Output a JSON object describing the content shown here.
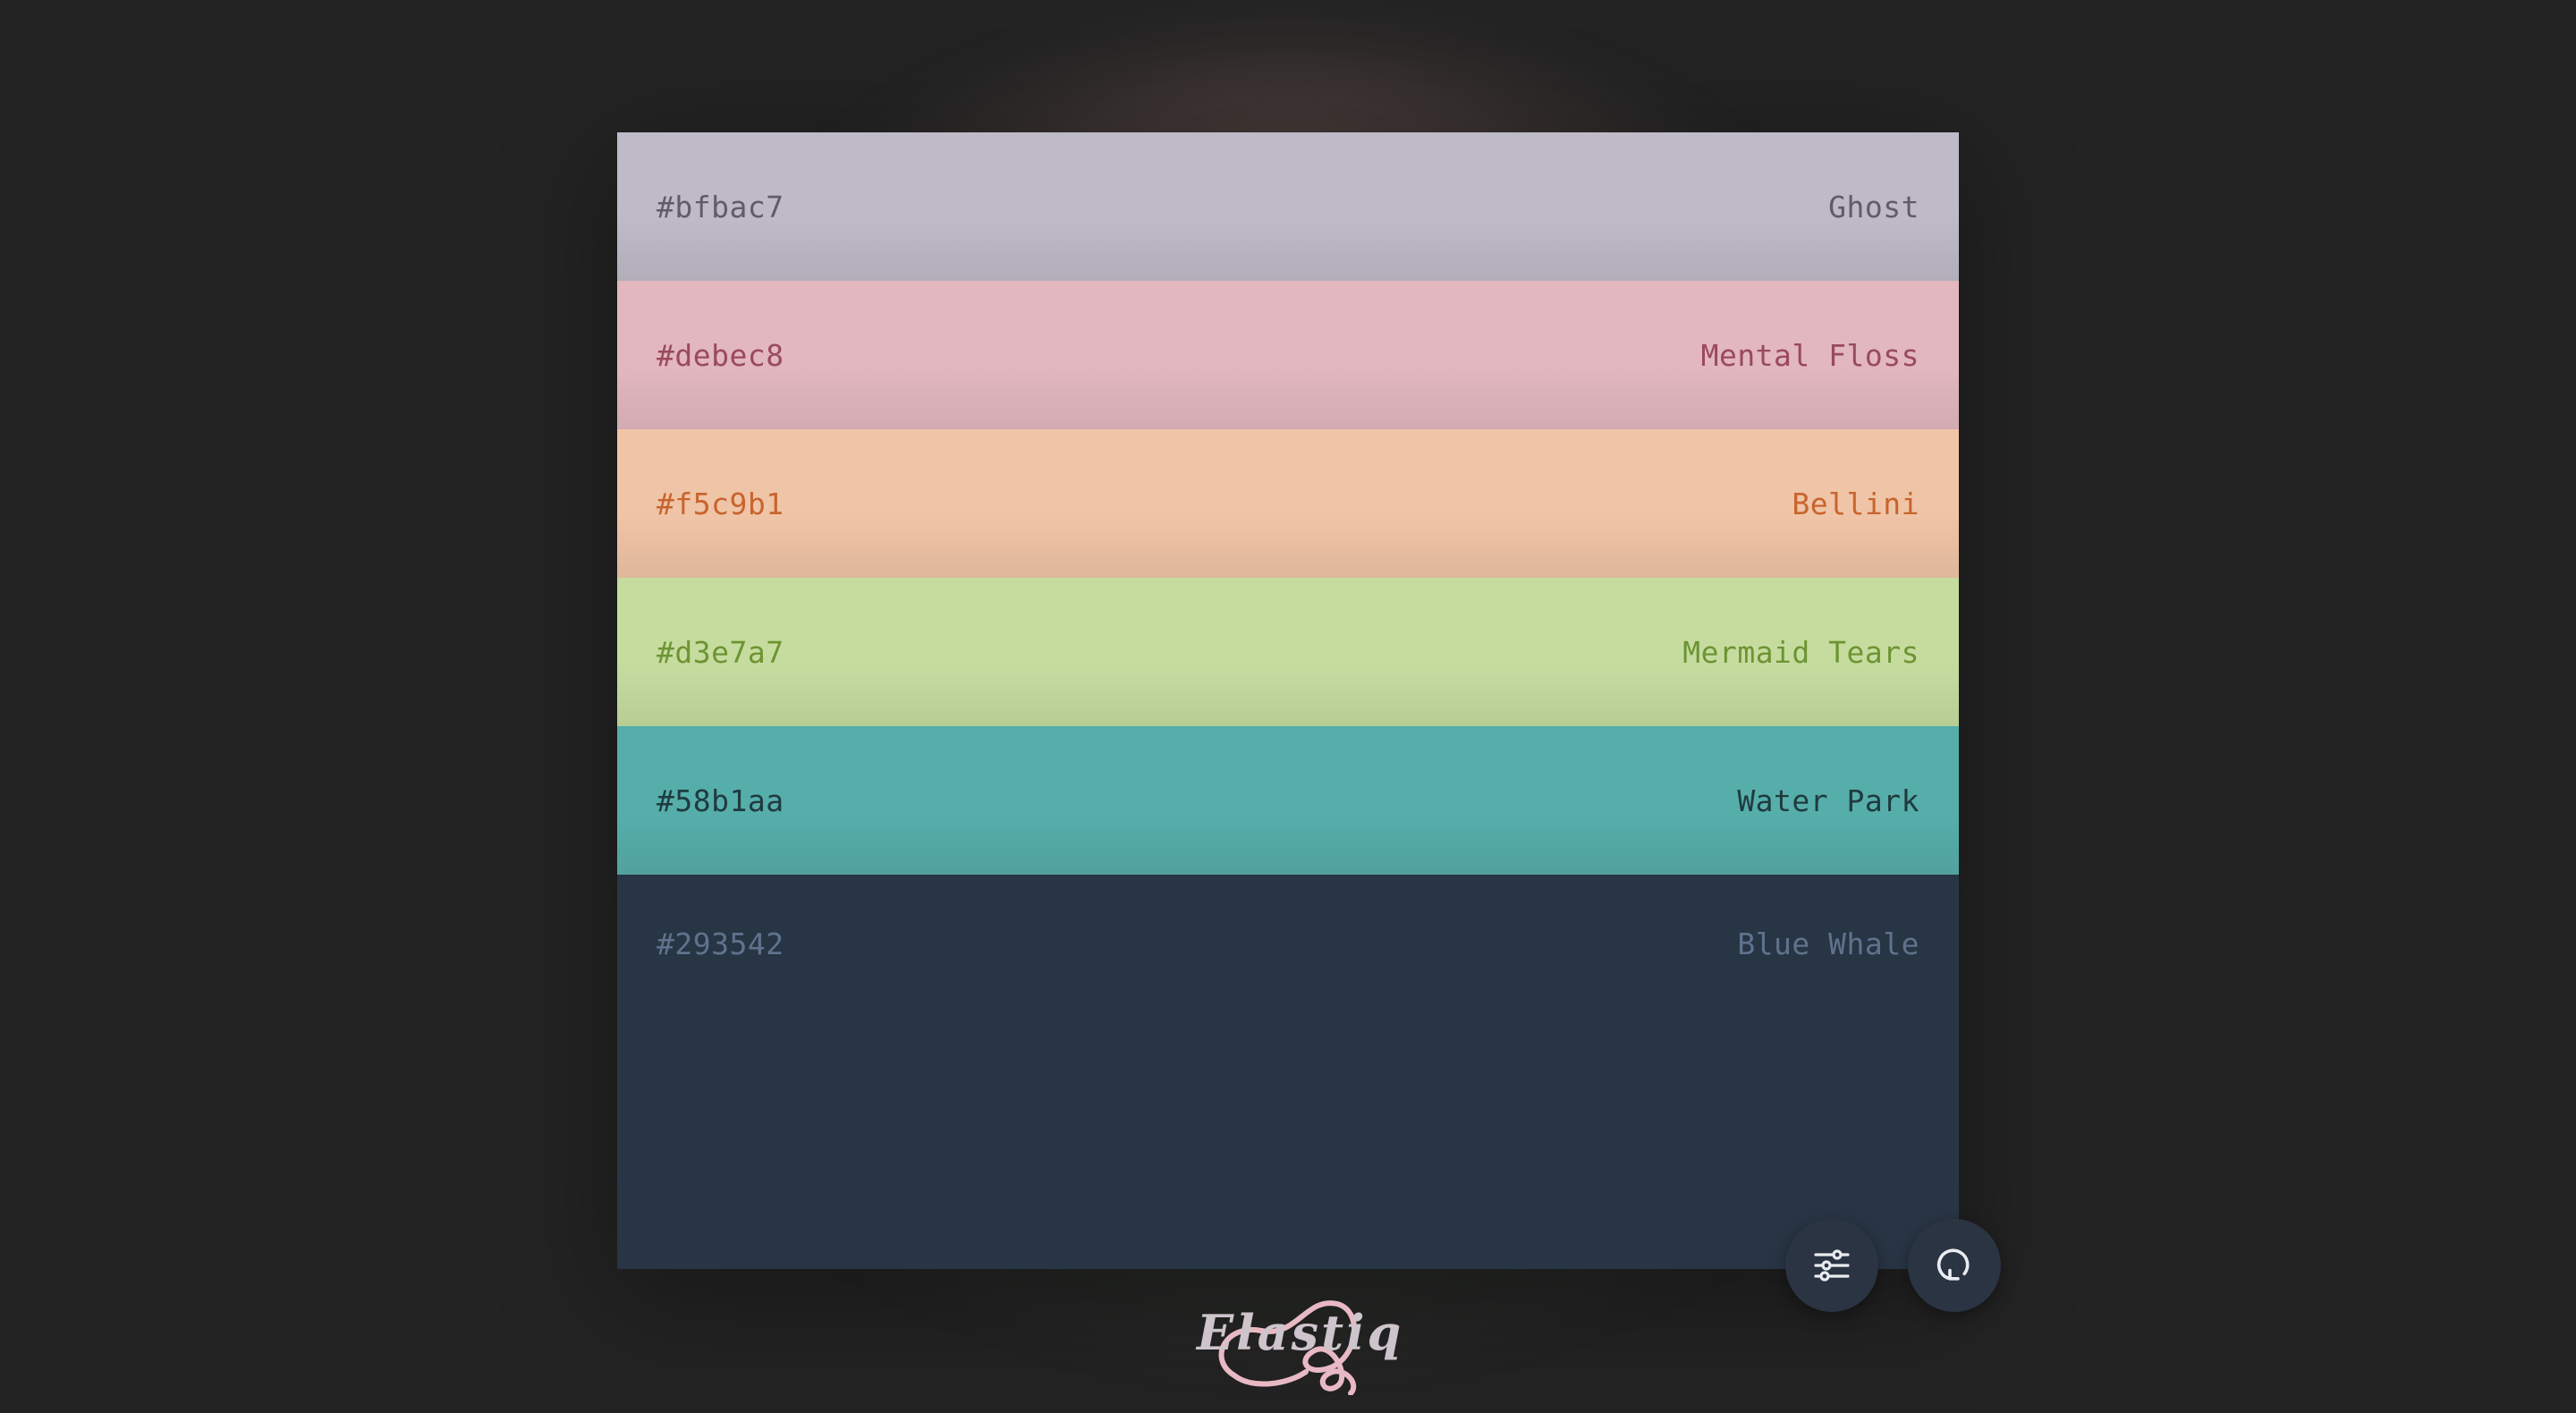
{
  "palette": {
    "swatches": [
      {
        "hex": "#bfbac7",
        "name": "Ghost",
        "bg": "#bfbac7",
        "fg": "#615b6d"
      },
      {
        "hex": "#debec8",
        "name": "Mental Floss",
        "bg": "#e2b7bf",
        "fg": "#9a4a5c"
      },
      {
        "hex": "#f5c9b1",
        "name": "Bellini",
        "bg": "#f0c4a6",
        "fg": "#c8642e"
      },
      {
        "hex": "#d3e7a7",
        "name": "Mermaid Tears",
        "bg": "#c6dc9f",
        "fg": "#6d9433"
      },
      {
        "hex": "#58b1aa",
        "name": "Water Park",
        "bg": "#56aeaa",
        "fg": "#1f3a3e"
      },
      {
        "hex": "#293542",
        "name": "Blue Whale",
        "bg": "#283544",
        "fg": "#5f738d"
      }
    ]
  },
  "controls": {
    "settings_icon": "sliders-icon",
    "regenerate_icon": "refresh-icon"
  },
  "brand": {
    "logo_text": "Elastiq",
    "logo_color": "#e8b9c4"
  }
}
